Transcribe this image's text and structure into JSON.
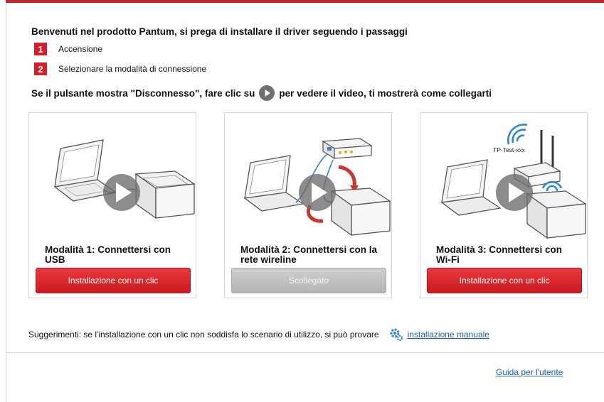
{
  "header": {
    "title": "Benvenuti nel prodotto Pantum, si prega di installare il driver seguendo i passaggi"
  },
  "steps": [
    {
      "number": "1",
      "label": "Accensione"
    },
    {
      "number": "2",
      "label": "Selezionare la modalità di connessione"
    }
  ],
  "hint": {
    "before": "Se il pulsante mostra \"Disconnesso\", fare clic su",
    "after": "per vedere il video, ti mostrerà come collegarti",
    "icon": "play-circle-icon"
  },
  "modes": [
    {
      "title": "Modalità 1: Connettersi con USB",
      "button": "Installazione con un clic",
      "state": "enabled"
    },
    {
      "title": "Modalità 2: Connettersi con la rete wireline",
      "button": "Scollegato",
      "state": "disabled"
    },
    {
      "title": "Modalità 3: Connettersi con Wi-Fi",
      "button": "Installazione con un clic",
      "state": "enabled",
      "ssid": "TP-Test-xxx"
    }
  ],
  "footer": {
    "tip": "Suggerimenti: se l'installazione con un clic non soddisfa lo scenario di utilizzo, si può provare",
    "manual_link": "installazione manuale",
    "guide_link": "Guida per l'utente"
  },
  "colors": {
    "accent": "#d41f2a",
    "link": "#1a5fa8",
    "disabled": "#b8b8b8"
  }
}
